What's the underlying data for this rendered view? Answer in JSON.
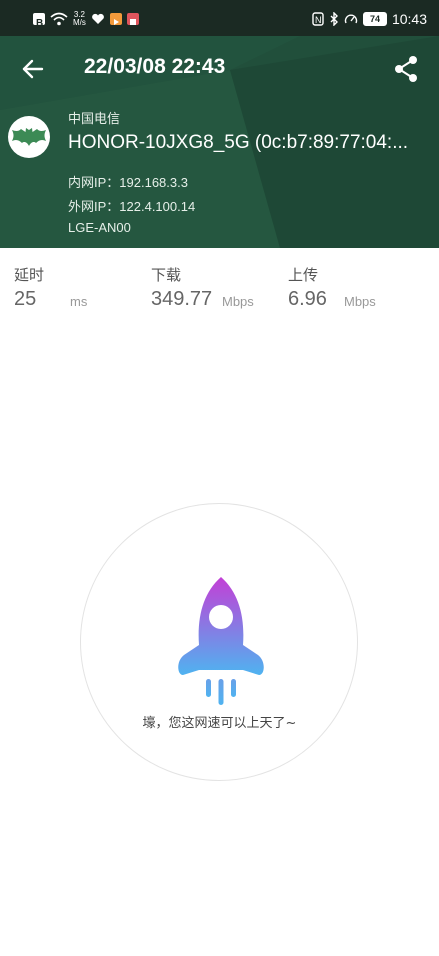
{
  "status_bar": {
    "network_speed_value": "3.2",
    "network_speed_unit": "M/s",
    "battery": "74",
    "time": "10:43"
  },
  "toolbar": {
    "title": "22/03/08 22:43",
    "back_icon": "arrow-left-icon",
    "share_icon": "share-icon"
  },
  "network": {
    "carrier": "中国电信",
    "ssid": "HONOR-10JXG8_5G (0c:b7:89:77:04:...",
    "lan_ip": "内网IP：192.168.3.3",
    "wan_ip": "外网IP：122.4.100.14",
    "device": "LGE-AN00"
  },
  "stats": {
    "latency": {
      "label": "延时",
      "value": "25",
      "unit": "ms"
    },
    "download": {
      "label": "下载",
      "value": "349.77",
      "unit": "Mbps"
    },
    "upload": {
      "label": "上传",
      "value": "6.96",
      "unit": "Mbps"
    }
  },
  "result": {
    "message": "壕，您这网速可以上天了~",
    "icon": "rocket-icon"
  },
  "colors": {
    "header_bg": "#214f3b",
    "status_bar_bg": "#1b2a23",
    "rocket_gradient_top": "#c33fd6",
    "rocket_gradient_bottom": "#4fb3f0"
  }
}
